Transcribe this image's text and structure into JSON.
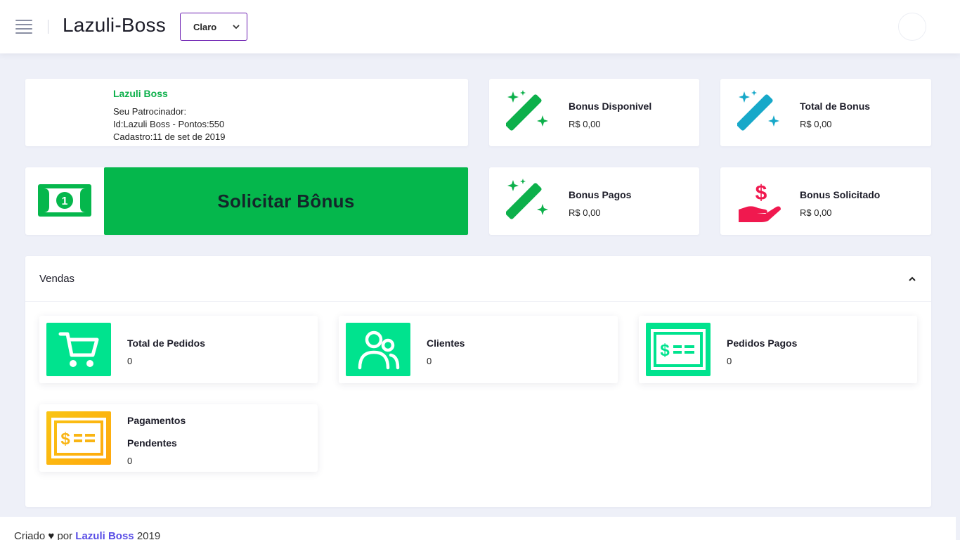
{
  "header": {
    "brand": "Lazuli-Boss",
    "theme_select": {
      "value": "Claro"
    }
  },
  "profile": {
    "name": "Lazuli Boss",
    "sponsor_label": "Seu Patrocinador:",
    "sponsor_line": "Id:Lazuli Boss - Pontos:550",
    "signup_line": "Cadastro:11 de set de 2019"
  },
  "stats": [
    {
      "title": "Bonus Disponivel",
      "value": "R$ 0,00",
      "icon": "magic-wand-icon",
      "color": "#0db04b"
    },
    {
      "title": "Total de Bonus",
      "value": "R$ 0,00",
      "icon": "magic-wand-icon",
      "color": "#17a8c9"
    },
    {
      "title": "Bonus Pagos",
      "value": "R$ 0,00",
      "icon": "magic-wand-icon",
      "color": "#0db04b"
    },
    {
      "title": "Bonus Solicitado",
      "value": "R$ 0,00",
      "icon": "hand-dollar-icon",
      "color": "#f0194f"
    }
  ],
  "request": {
    "button_label": "Solicitar Bônus",
    "icon": "money-bill-icon",
    "color": "#05b74c"
  },
  "vendas": {
    "title": "Vendas",
    "items": [
      {
        "title": "Total de Pedidos",
        "value": "0",
        "icon": "cart-icon"
      },
      {
        "title": "Clientes",
        "value": "0",
        "icon": "users-icon"
      },
      {
        "title": "Pedidos Pagos",
        "value": "0",
        "icon": "payment-card-icon"
      },
      {
        "title_line1": "Pagamentos",
        "title_line2": "Pendentes",
        "value": "0",
        "icon": "payment-card-icon"
      }
    ]
  },
  "footer": {
    "prefix": "Criado",
    "by": "por",
    "link": "Lazuli Boss",
    "year": "2019"
  }
}
